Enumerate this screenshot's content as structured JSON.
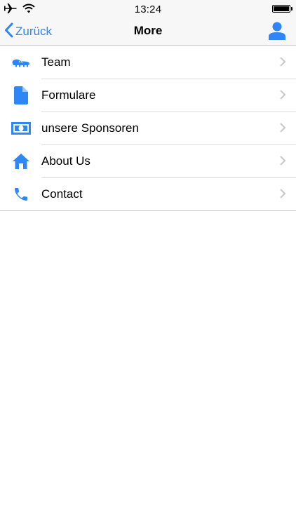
{
  "status_bar": {
    "time": "13:24",
    "battery_level": 1.0,
    "icons": [
      "airplane-icon",
      "wifi-icon",
      "battery-icon"
    ]
  },
  "nav_bar": {
    "back_label": "Zurück",
    "title": "More",
    "right_icon": "person-icon"
  },
  "menu": {
    "items": [
      {
        "label": "Team",
        "icon": "soccer-shoe-icon"
      },
      {
        "label": "Formulare",
        "icon": "document-icon"
      },
      {
        "label": "unsere Sponsoren",
        "icon": "money-icon"
      },
      {
        "label": "About Us",
        "icon": "home-icon"
      },
      {
        "label": "Contact",
        "icon": "phone-icon"
      }
    ]
  },
  "colors": {
    "accent": "#2f86f6",
    "bar_background": "#f7f7f7",
    "separator": "#c8c7cc",
    "chevron": "#c7c7cc"
  }
}
